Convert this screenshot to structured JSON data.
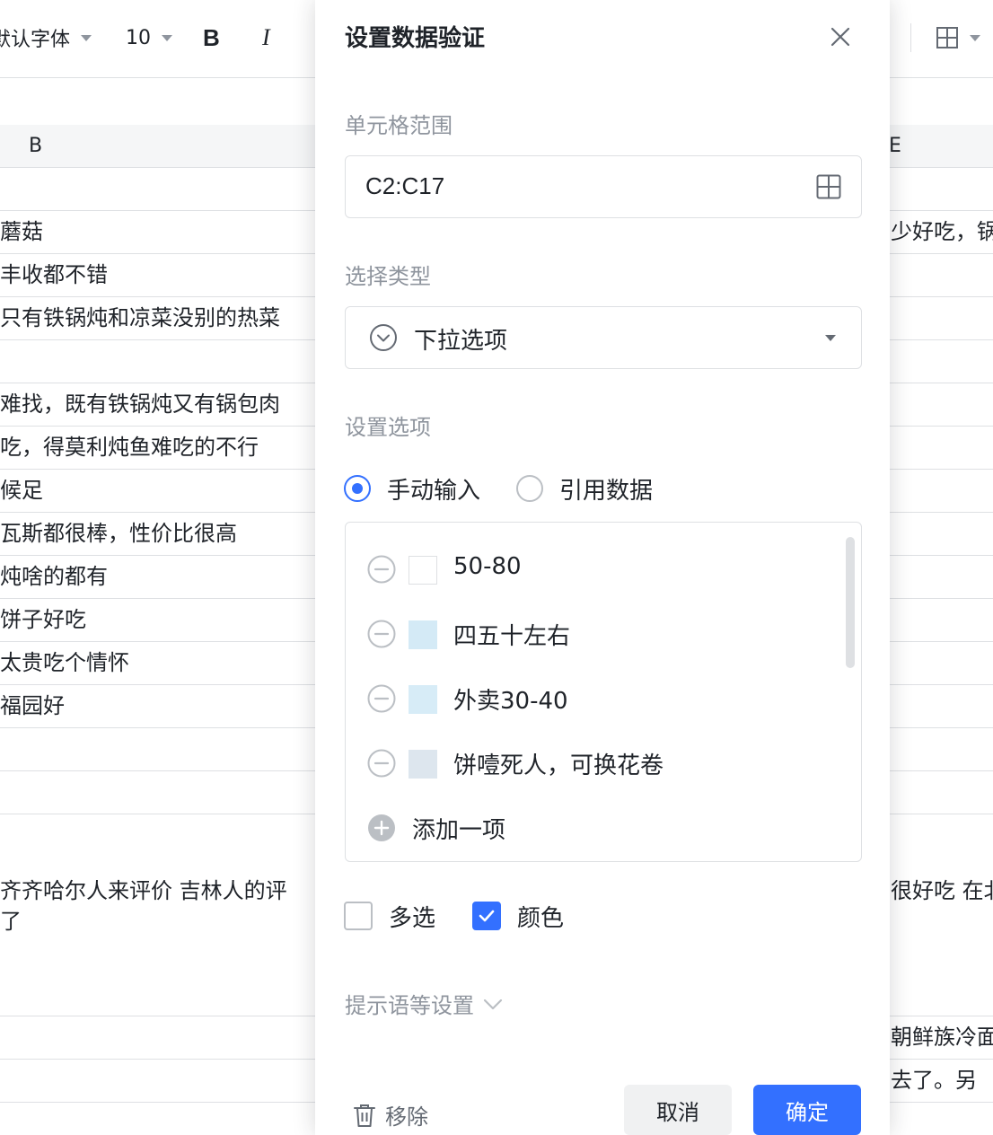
{
  "toolbar": {
    "font_name": "默认字体",
    "font_size": "10",
    "bold_label": "B",
    "italic_label": "I"
  },
  "sheet": {
    "col_b_header": "B",
    "col_e_header": "E",
    "rows": [
      {
        "b": "",
        "r": ""
      },
      {
        "b": "蘑菇",
        "r": "少好吃，锅"
      },
      {
        "b": "丰收都不错",
        "r": ""
      },
      {
        "b": "只有铁锅炖和凉菜没别的热菜",
        "r": ""
      },
      {
        "b": "",
        "r": ""
      },
      {
        "b": "难找，既有铁锅炖又有锅包肉",
        "r": ""
      },
      {
        "b": "吃，得莫利炖鱼难吃的不行",
        "r": ""
      },
      {
        "b": "候足",
        "r": ""
      },
      {
        "b": "瓦斯都很棒，性价比很高",
        "r": ""
      },
      {
        "b": "炖啥的都有",
        "r": ""
      },
      {
        "b": "饼子好吃",
        "r": ""
      },
      {
        "b": "太贵吃个情怀",
        "r": ""
      },
      {
        "b": "福园好",
        "r": ""
      },
      {
        "b": "",
        "r": ""
      },
      {
        "b": "",
        "r": ""
      }
    ],
    "tall_row": {
      "b_line1": "齐齐哈尔人来评价 吉林人的评",
      "b_line2": "了",
      "r_line1": "很好吃 在北"
    },
    "bottom_rows": [
      {
        "b": "",
        "r": "朝鲜族冷面"
      },
      {
        "b": "",
        "r": "去了。另"
      }
    ]
  },
  "dialog": {
    "title": "设置数据验证",
    "range_label": "单元格范围",
    "range_value": "C2:C17",
    "type_label": "选择类型",
    "type_value": "下拉选项",
    "options_label": "设置选项",
    "radio_manual": "手动输入",
    "radio_reference": "引用数据",
    "manual_selected": true,
    "options": [
      {
        "text": "50-80",
        "color": "#ffffff"
      },
      {
        "text": "四五十左右",
        "color": "#d4eaf6"
      },
      {
        "text": "外卖30-40",
        "color": "#d7ecf7"
      },
      {
        "text": "饼噎死人，可换花卷",
        "color": "#dde6ee"
      }
    ],
    "add_option": "添加一项",
    "multi_select": "多选",
    "multi_checked": false,
    "color_label": "颜色",
    "color_checked": true,
    "advanced": "提示语等设置",
    "remove": "移除",
    "cancel": "取消",
    "ok": "确定"
  },
  "colors": {
    "accent": "#3370ff",
    "border": "#dee0e3",
    "muted": "#8f959e"
  }
}
